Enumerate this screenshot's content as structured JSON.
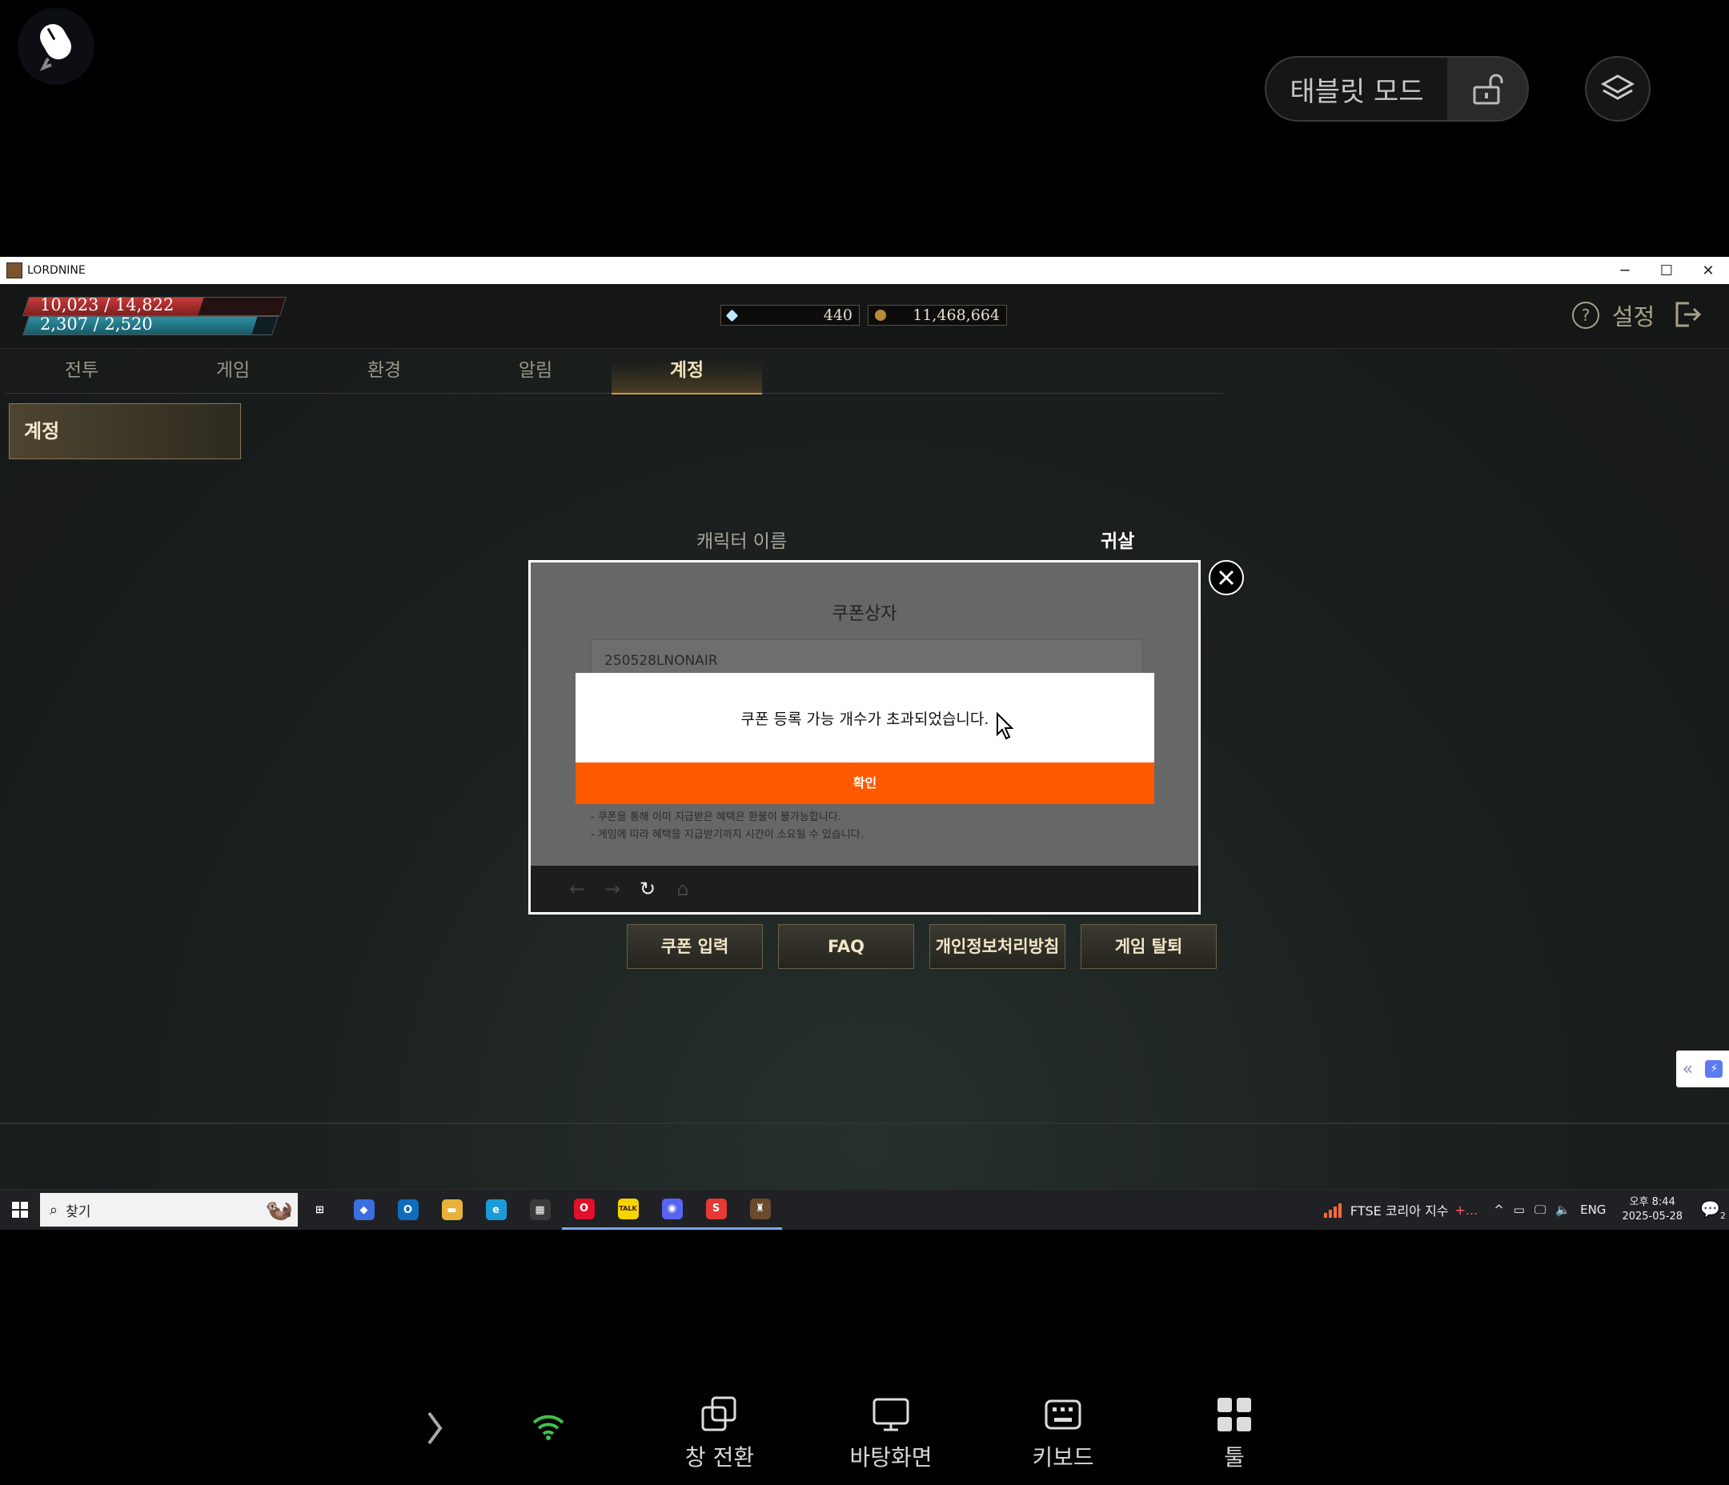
{
  "remote_top": {
    "tablet_mode_label": "태블릿 모드"
  },
  "window": {
    "title": "LORDNINE",
    "minimize": "─",
    "maximize": "☐",
    "close": "✕"
  },
  "hud": {
    "hp": "10,023 / 14,822",
    "mp": "2,307 / 2,520",
    "diamonds": "440",
    "gold": "11,468,664",
    "help": "?",
    "settings_label": "설정"
  },
  "tabs": [
    {
      "label": "전투"
    },
    {
      "label": "게임"
    },
    {
      "label": "환경"
    },
    {
      "label": "알림"
    },
    {
      "label": "계정"
    }
  ],
  "sidebar": {
    "item": "계정"
  },
  "account": {
    "character_name_label": "캐릭터 이름",
    "character_name_value": "귀살"
  },
  "buttons": {
    "coupon": "쿠폰 입력",
    "faq": "FAQ",
    "privacy": "개인정보처리방침",
    "withdraw": "게임 탈퇴"
  },
  "coupon_modal": {
    "title": "쿠폰상자",
    "input_value": "250528LNONAIR",
    "notes": [
      "- 쿠폰을 통해 이미 지급받은 혜택은 환불이 불가능합니다.",
      "- 게임에 따라 혜택을 지급받기까지 시간이 소요될 수 있습니다."
    ],
    "nav": {
      "back": "←",
      "forward": "→",
      "reload": "↻",
      "home": "⌂"
    }
  },
  "alert": {
    "message": "쿠폰 등록 가능 개수가 초과되었습니다.",
    "confirm": "확인"
  },
  "taskbar": {
    "search_placeholder": "찾기",
    "ticker_label": "FTSE 코리아 지수",
    "ticker_delta": "+...",
    "tray_caret": "^",
    "ime": "ENG",
    "time": "오후 8:44",
    "date": "2025-05-28",
    "notif_count": "2",
    "apps": [
      {
        "name": "task-view",
        "glyph": "⊞",
        "color": "#202124"
      },
      {
        "name": "copilot",
        "glyph": "◆",
        "color": "#3b6fe0"
      },
      {
        "name": "outlook",
        "glyph": "O",
        "color": "#0f6cbd"
      },
      {
        "name": "file-explorer",
        "glyph": "▬",
        "color": "#e8b23a"
      },
      {
        "name": "edge",
        "glyph": "e",
        "color": "#1a9bd8"
      },
      {
        "name": "store",
        "glyph": "▦",
        "color": "#3a3a3a"
      },
      {
        "name": "opera",
        "glyph": "O",
        "color": "#e0102a"
      },
      {
        "name": "kakaotalk",
        "glyph": "TALK",
        "color": "#f7d300"
      },
      {
        "name": "discord",
        "glyph": "◉",
        "color": "#5865f2"
      },
      {
        "name": "s-app",
        "glyph": "S",
        "color": "#e53935"
      },
      {
        "name": "lordnine",
        "glyph": "♜",
        "color": "#6b4a2e"
      }
    ]
  },
  "remote_bottom": {
    "window_switch": "창 전환",
    "desktop": "바탕화면",
    "keyboard": "키보드",
    "tools": "툴"
  }
}
